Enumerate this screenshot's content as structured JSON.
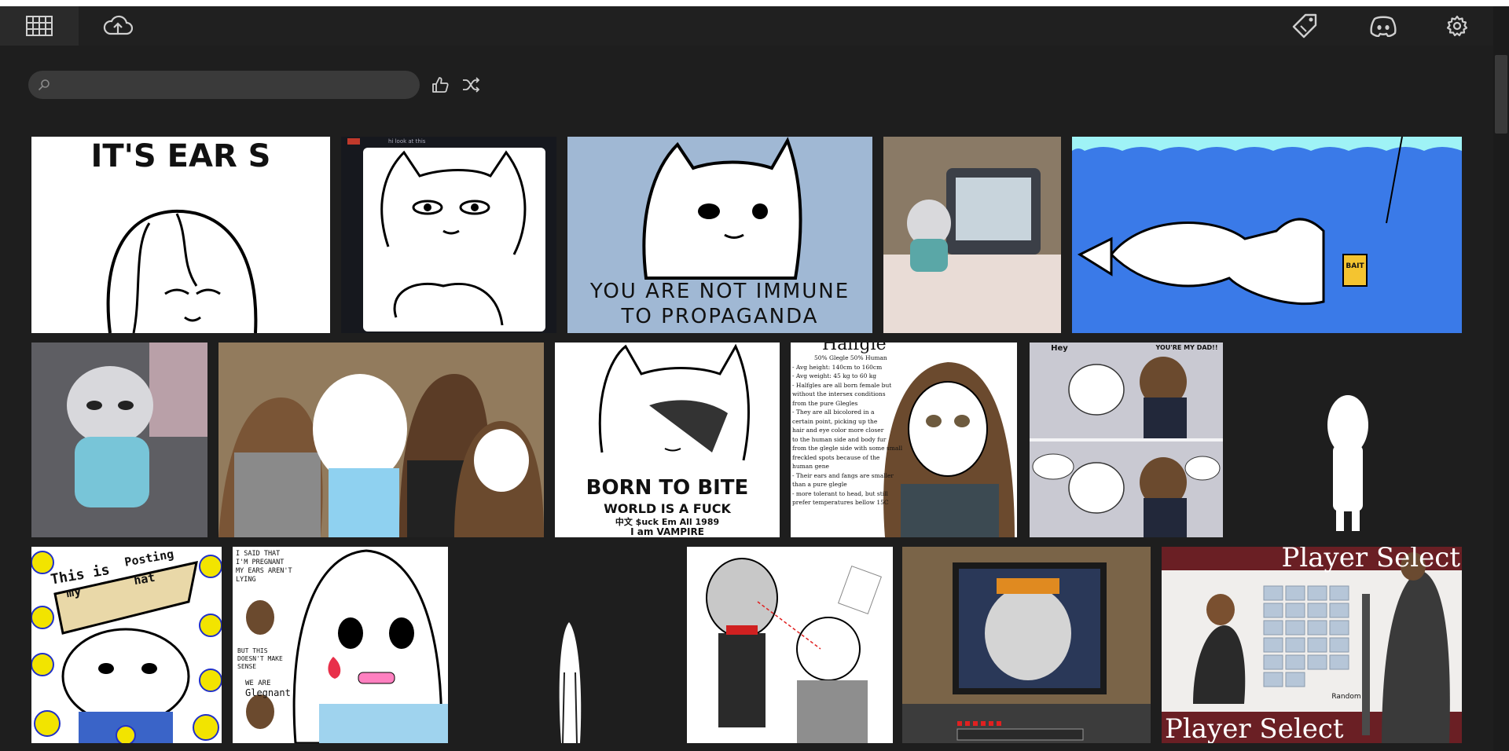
{
  "colors": {
    "background": "#1e1e1e",
    "toolbar": "#202020",
    "search_bg": "#3a3a3a",
    "icon": "#cfcfcf"
  },
  "toolbar": {
    "left_icons": [
      "grid-icon",
      "cloud-upload-icon"
    ],
    "right_icons": [
      "tag-icon",
      "discord-icon",
      "gear-icon"
    ]
  },
  "search": {
    "value": "",
    "placeholder": ""
  },
  "gallery": {
    "tile_captions": {
      "t1": "IT'S EAR      S",
      "t3a": "YOU ARE NOT IMMUNE",
      "t3b": "TO PROPAGANDA",
      "t8a": "BORN TO BITE",
      "t8b": "WORLD IS A FUCK",
      "t8c": "中文 $uck Em All 1989",
      "t8d": "I am VAMPIRE",
      "t9title": "Halfgle",
      "t9sub": "50% Glegle 50% Human",
      "t9l1": "- Avg height: 140cm to 160cm",
      "t9l2": "- Avg weight: 45 kg to 60 kg",
      "t9l3": "- Halfgles are all born female but",
      "t9l4": "without the intersex conditions",
      "t9l5": "from the pure Glegles",
      "t9l6": "- They are all bicolored in a",
      "t9l7": "certain point, picking up the",
      "t9l8": "hair and eye color more closer",
      "t9l9": "to the human side and body fur",
      "t9l10": "from the glegle side with some small",
      "t9l11": "freckled spots because of the",
      "t9l12": "human gene",
      "t9l13": "- Their ears and fangs are smaller",
      "t9l14": "than a pure glegle",
      "t9l15": "- more tolerant to head, but still",
      "t9l16": "prefer temperatures bellow 15C",
      "t12a": "This is",
      "t12b": "my",
      "t12c": "Posting",
      "t12d": "hat",
      "t13a": "I SAID THAT",
      "t13b": "I'M PREGNANT",
      "t13c": "MY EARS AREN'T",
      "t13d": "LYING",
      "t13e": "BUT THIS",
      "t13f": "DOESN'T MAKE",
      "t13g": "SENSE",
      "t13h": "WE ARE",
      "t13i": "Glegnant",
      "t17a": "Player Select",
      "t17b": "Player Select",
      "t17c": "Random",
      "t10a": "Hey",
      "t10b": "YOU'RE MY DAD!!",
      "t2post": "hi look at this",
      "t5bait": "BAIT"
    }
  }
}
